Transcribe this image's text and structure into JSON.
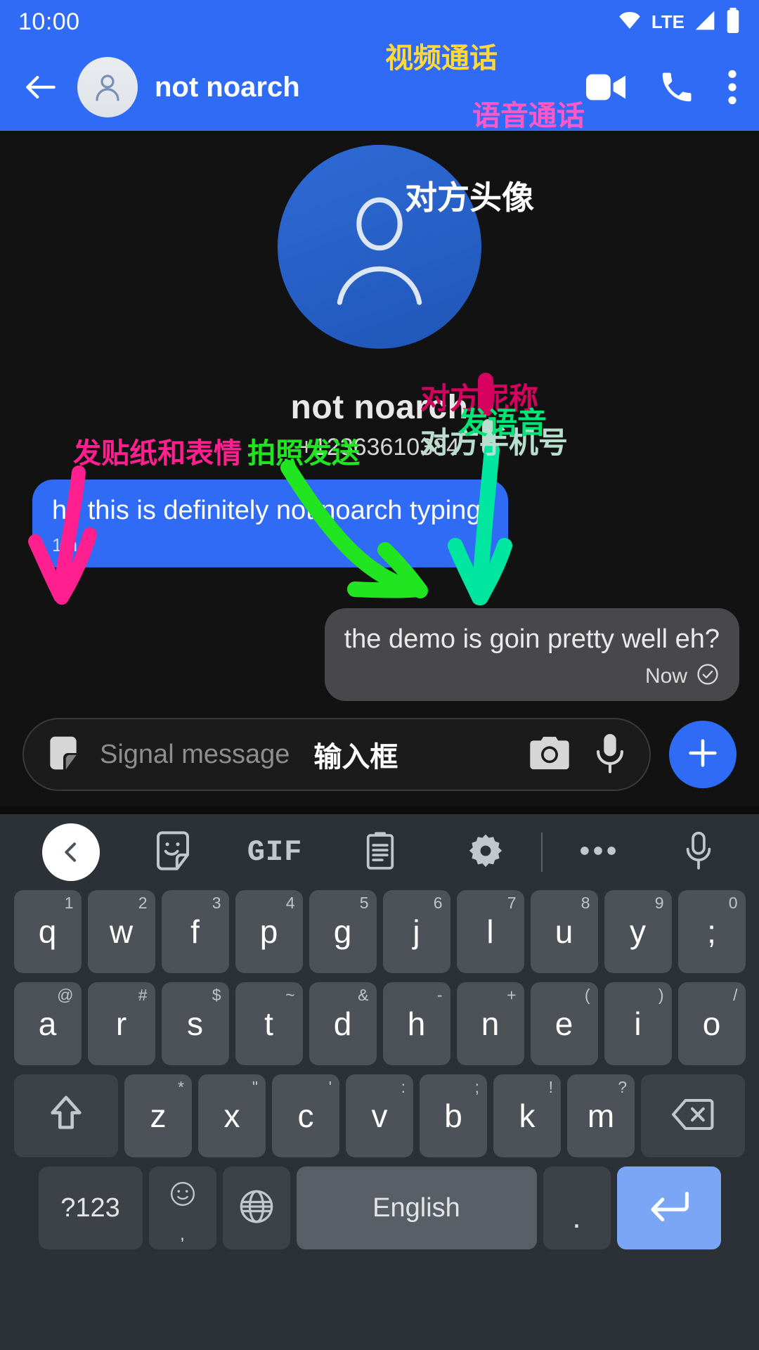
{
  "status_bar": {
    "time": "10:00",
    "network_label": "LTE",
    "icons": [
      "wifi-icon",
      "signal-icon",
      "battery-icon"
    ]
  },
  "app_bar": {
    "back_icon": "back-arrow-icon",
    "avatar_icon": "contact-avatar-icon",
    "title": "not noarch",
    "video_call_icon": "video-camera-icon",
    "voice_call_icon": "phone-icon",
    "overflow_icon": "more-vertical-icon"
  },
  "profile": {
    "avatar_icon": "person-avatar-icon",
    "name": "not noarch",
    "phone": "+12363610384"
  },
  "messages": [
    {
      "direction": "outgoing",
      "text": "hi! this is definitely not noarch typing.",
      "time": "1m",
      "status_icon": ""
    },
    {
      "direction": "incoming",
      "text": "the demo is goin pretty well eh?",
      "time": "Now",
      "status_icon": "check-circle-icon"
    }
  ],
  "compose": {
    "sticker_icon": "sticker-icon",
    "placeholder": "Signal message",
    "cn_label": "输入框",
    "camera_icon": "camera-icon",
    "mic_icon": "microphone-icon",
    "plus_icon": "plus-icon"
  },
  "keyboard": {
    "toolbar": [
      {
        "name": "keyboard-back-button",
        "icon": "chevron-left-icon",
        "label": ""
      },
      {
        "name": "keyboard-sticker-button",
        "icon": "sticker-face-icon",
        "label": ""
      },
      {
        "name": "keyboard-gif-button",
        "icon": "gif-icon",
        "label": "GIF"
      },
      {
        "name": "keyboard-clipboard-button",
        "icon": "clipboard-icon",
        "label": ""
      },
      {
        "name": "keyboard-settings-button",
        "icon": "gear-icon",
        "label": ""
      },
      {
        "name": "keyboard-more-button",
        "icon": "more-horizontal-icon",
        "label": ""
      },
      {
        "name": "keyboard-mic-button",
        "icon": "microphone-icon",
        "label": ""
      }
    ],
    "row1": [
      {
        "main": "q",
        "sup": "1"
      },
      {
        "main": "w",
        "sup": "2"
      },
      {
        "main": "f",
        "sup": "3"
      },
      {
        "main": "p",
        "sup": "4"
      },
      {
        "main": "g",
        "sup": "5"
      },
      {
        "main": "j",
        "sup": "6"
      },
      {
        "main": "l",
        "sup": "7"
      },
      {
        "main": "u",
        "sup": "8"
      },
      {
        "main": "y",
        "sup": "9"
      },
      {
        "main": ";",
        "sup": "0"
      }
    ],
    "row2": [
      {
        "main": "a",
        "sup": "@"
      },
      {
        "main": "r",
        "sup": "#"
      },
      {
        "main": "s",
        "sup": "$"
      },
      {
        "main": "t",
        "sup": "~"
      },
      {
        "main": "d",
        "sup": "&"
      },
      {
        "main": "h",
        "sup": "-"
      },
      {
        "main": "n",
        "sup": "+"
      },
      {
        "main": "e",
        "sup": "("
      },
      {
        "main": "i",
        "sup": ")"
      },
      {
        "main": "o",
        "sup": "/"
      }
    ],
    "row3": [
      {
        "main": "z",
        "sup": "*"
      },
      {
        "main": "x",
        "sup": "\""
      },
      {
        "main": "c",
        "sup": "'"
      },
      {
        "main": "v",
        "sup": ":"
      },
      {
        "main": "b",
        "sup": ";"
      },
      {
        "main": "k",
        "sup": "!"
      },
      {
        "main": "m",
        "sup": "?"
      }
    ],
    "shift_icon": "shift-arrow-icon",
    "backspace_icon": "backspace-icon",
    "symbols_label": "?123",
    "emoji_icon": "emoji-smiley-icon",
    "emoji_sub": ",",
    "globe_icon": "globe-icon",
    "space_label": "English",
    "period_label": ".",
    "enter_icon": "enter-arrow-icon"
  },
  "annotations": {
    "video_call": "视频通话",
    "voice_call": "语音通话",
    "avatar": "对方头像",
    "nickname": "对方昵称",
    "phone_number": "对方手机号",
    "send_voice": "发语音",
    "send_sticker": "发贴纸和表情",
    "send_photo": "拍照发送"
  }
}
